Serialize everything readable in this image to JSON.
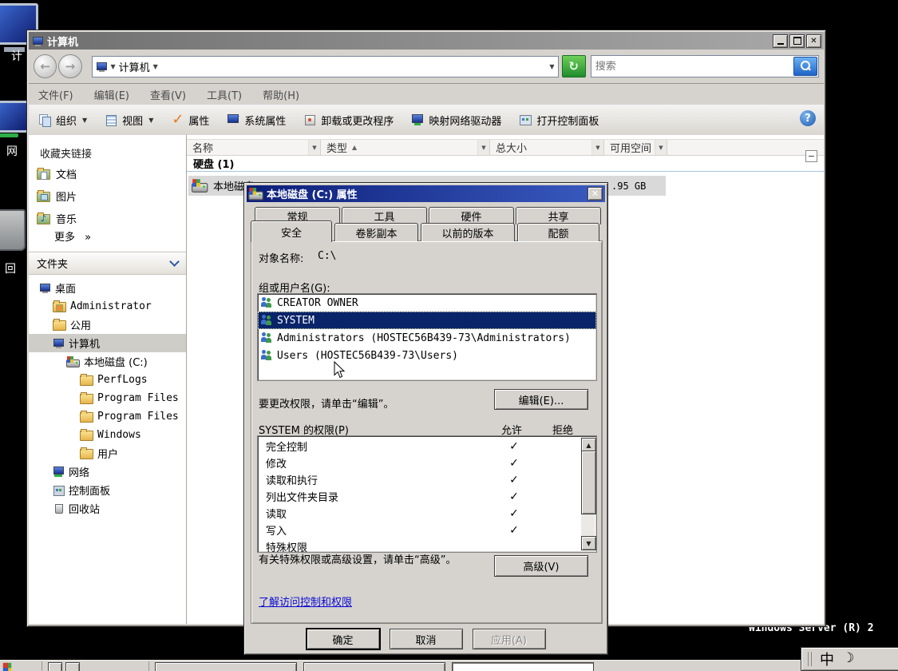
{
  "desktop": {
    "icon_labels": {
      "computer": "计",
      "network": "网",
      "recycle": "回"
    },
    "watermark": "Windows Server (R) 2"
  },
  "explorer": {
    "title": "计算机",
    "address": {
      "breadcrumb": "计算机",
      "search_placeholder": "搜索"
    },
    "menus": [
      "文件(F)",
      "编辑(E)",
      "查看(V)",
      "工具(T)",
      "帮助(H)"
    ],
    "toolbar": [
      {
        "label": "组织",
        "icon": "organize",
        "dropdown": true
      },
      {
        "label": "视图",
        "icon": "views",
        "dropdown": true
      },
      {
        "label": "属性",
        "icon": "check"
      },
      {
        "label": "系统属性",
        "icon": "monitor-check"
      },
      {
        "label": "卸载或更改程序",
        "icon": "package"
      },
      {
        "label": "映射网络驱动器",
        "icon": "monitor-net"
      },
      {
        "label": "打开控制面板",
        "icon": "panel"
      }
    ],
    "sidebar": {
      "favorites_title": "收藏夹链接",
      "favorites": [
        {
          "label": "文档",
          "icon": "doc"
        },
        {
          "label": "图片",
          "icon": "pic"
        },
        {
          "label": "音乐",
          "icon": "music"
        }
      ],
      "more_label": "更多",
      "more_arrows": "»",
      "folders_title": "文件夹",
      "tree": [
        {
          "label": "桌面",
          "indent": 0,
          "icon": "desktop"
        },
        {
          "label": "Administrator",
          "indent": 1,
          "icon": "user-folder",
          "latin": true
        },
        {
          "label": "公用",
          "indent": 1,
          "icon": "folder"
        },
        {
          "label": "计算机",
          "indent": 1,
          "icon": "computer",
          "selected": true
        },
        {
          "label": "本地磁盘 (C:)",
          "indent": 2,
          "icon": "disk"
        },
        {
          "label": "PerfLogs",
          "indent": 3,
          "icon": "folder",
          "latin": true
        },
        {
          "label": "Program Files",
          "indent": 3,
          "icon": "folder",
          "latin": true
        },
        {
          "label": "Program Files",
          "indent": 3,
          "icon": "folder",
          "latin": true
        },
        {
          "label": "Windows",
          "indent": 3,
          "icon": "folder",
          "latin": true
        },
        {
          "label": "用户",
          "indent": 3,
          "icon": "folder"
        },
        {
          "label": "网络",
          "indent": 1,
          "icon": "network"
        },
        {
          "label": "控制面板",
          "indent": 1,
          "icon": "control-panel"
        },
        {
          "label": "回收站",
          "indent": 1,
          "icon": "recycle"
        }
      ]
    },
    "filelist": {
      "columns": {
        "name": "名称",
        "type": "类型",
        "total": "总大小",
        "free": "可用空间"
      },
      "group_header": "硬盘 (1)",
      "row": {
        "name": "本地磁盘 (C:)",
        "free_visible": ".95 GB"
      }
    }
  },
  "dialog": {
    "title": "本地磁盘 (C:) 属性",
    "tabs_back": [
      "常规",
      "工具",
      "硬件",
      "共享"
    ],
    "tabs_front": [
      "安全",
      "卷影副本",
      "以前的版本",
      "配额"
    ],
    "object_label": "对象名称:",
    "object_value": "C:\\",
    "groups_label": "组或用户名(G):",
    "groups": [
      {
        "name": "CREATOR OWNER"
      },
      {
        "name": "SYSTEM",
        "selected": true
      },
      {
        "name": "Administrators (HOSTEC56B439-73\\Administrators)"
      },
      {
        "name": "Users (HOSTEC56B439-73\\Users)"
      }
    ],
    "edit_hint": "要更改权限，请单击“编辑”。",
    "edit_button": "编辑(E)...",
    "perm_header": "SYSTEM 的权限(P)",
    "allow_label": "允许",
    "deny_label": "拒绝",
    "permissions": [
      {
        "name": "完全控制",
        "allow": true
      },
      {
        "name": "修改",
        "allow": true
      },
      {
        "name": "读取和执行",
        "allow": true
      },
      {
        "name": "列出文件夹目录",
        "allow": true
      },
      {
        "name": "读取",
        "allow": true
      },
      {
        "name": "写入",
        "allow": true
      },
      {
        "name": "特殊权限",
        "partial": true
      }
    ],
    "advanced_hint": "有关特殊权限或高级设置，请单击“高级”。",
    "advanced_button": "高级(V)",
    "link": "了解访问控制和权限",
    "ok_button": "确定",
    "cancel_button": "取消",
    "apply_button": "应用(A)"
  },
  "ime": {
    "cn": "中",
    "moon": "☽"
  }
}
